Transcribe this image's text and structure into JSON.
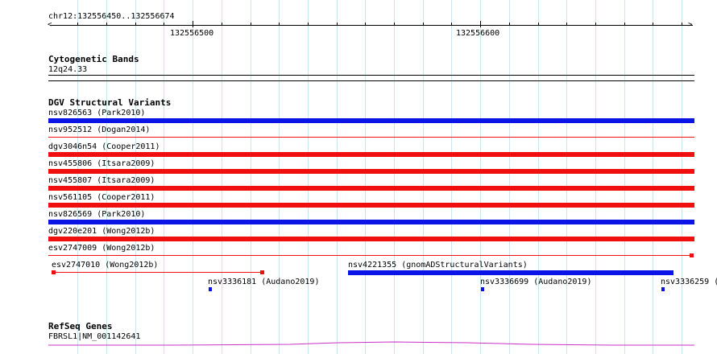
{
  "ruler": {
    "location": "chr12:132556450..132556674",
    "ticks": [
      {
        "label": "132556500"
      },
      {
        "label": "132556600"
      }
    ]
  },
  "cytobands": {
    "title": "Cytogenetic Bands",
    "band": "12q24.33"
  },
  "dgv": {
    "title": "DGV Structural Variants",
    "colors": {
      "blue": "#0a14e6",
      "red": "#f00f0f"
    },
    "rows": [
      {
        "label": "nsv826563 (Park2010)",
        "color": "blue",
        "style": "thick"
      },
      {
        "label": "nsv952512 (Dogan2014)",
        "color": "red",
        "style": "thin"
      },
      {
        "label": "dgv3046n54 (Cooper2011)",
        "color": "red",
        "style": "thick"
      },
      {
        "label": "nsv455806 (Itsara2009)",
        "color": "red",
        "style": "thick"
      },
      {
        "label": "nsv455807 (Itsara2009)",
        "color": "red",
        "style": "thick"
      },
      {
        "label": "nsv561105 (Cooper2011)",
        "color": "red",
        "style": "thick"
      },
      {
        "label": "nsv826569 (Park2010)",
        "color": "blue",
        "style": "thick"
      },
      {
        "label": "dgv220e201 (Wong2012b)",
        "color": "red",
        "style": "thick"
      },
      {
        "label": "esv2747009 (Wong2012b)",
        "color": "red",
        "style": "thin-end"
      }
    ],
    "extra": {
      "esv2747010": "esv2747010 (Wong2012b)",
      "nsv4221355": "nsv4221355 (gnomADStructuralVariants)",
      "nsv3336181": "nsv3336181 (Audano2019)",
      "nsv3336699": "nsv3336699 (Audano2019)",
      "nsv3336259": "nsv3336259 ("
    }
  },
  "refseq": {
    "title": "RefSeq Genes",
    "gene": "FBRSL1|NM_001142641",
    "color": "#c832c8"
  }
}
